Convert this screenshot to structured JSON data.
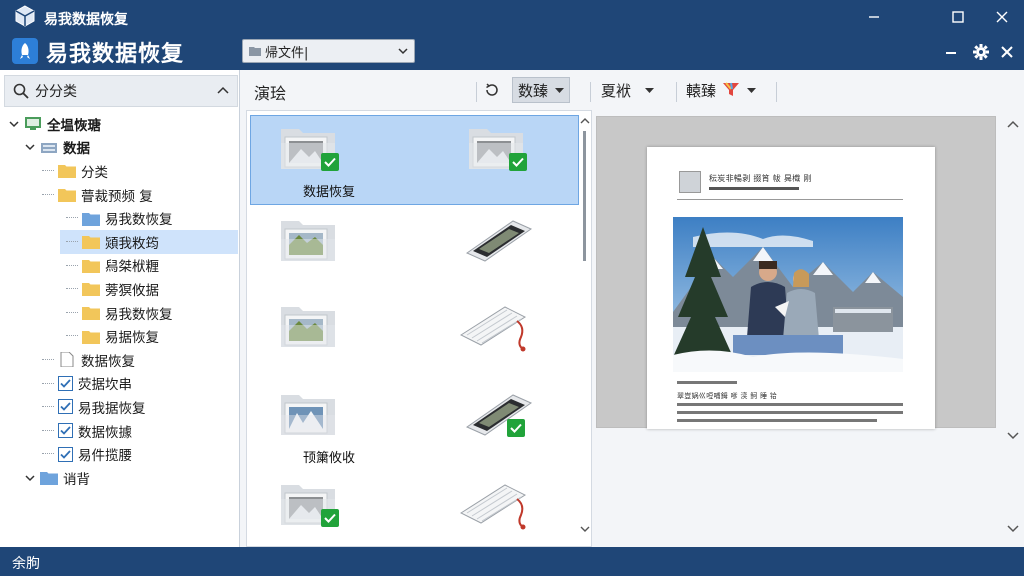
{
  "window": {
    "title": "易我数据恢复",
    "controls": [
      "minimize",
      "maximize",
      "close"
    ]
  },
  "header": {
    "app_name": "易我数据恢复",
    "location_select": {
      "value": "帰文件|"
    }
  },
  "sidebar": {
    "search_label": "分分类",
    "tree": [
      {
        "label": "全塭恢瑭",
        "level": 0,
        "expander": "open",
        "icon": "computer-icon",
        "bold": true
      },
      {
        "label": "数据",
        "level": 1,
        "expander": "open",
        "icon": "drive-icon",
        "bold": true
      },
      {
        "label": "分类",
        "level": 2,
        "icon": "folder-icon"
      },
      {
        "label": "瞢裁预频  复",
        "level": 2,
        "icon": "folder-icon"
      },
      {
        "label": "易我数恢复",
        "level": 3,
        "icon": "folder-blue-icon"
      },
      {
        "label": "熲我敉筠",
        "level": 3,
        "icon": "folder-icon",
        "selected": true
      },
      {
        "label": "舄桀栿糎",
        "level": 3,
        "icon": "folder-icon"
      },
      {
        "label": "蒡猽攸据",
        "level": 3,
        "icon": "folder-icon"
      },
      {
        "label": "易我数恢复",
        "level": 3,
        "icon": "folder-icon"
      },
      {
        "label": "易据恢复",
        "level": 3,
        "icon": "folder-icon"
      },
      {
        "label": "数据恢复",
        "level": 2,
        "icon": "file-icon"
      },
      {
        "label": "荧据坎串",
        "level": 2,
        "icon": "checkbox-icon"
      },
      {
        "label": "易我据恢复",
        "level": 2,
        "icon": "checkbox-icon"
      },
      {
        "label": "数据恢據",
        "level": 2,
        "icon": "checkbox-icon"
      },
      {
        "label": "易件揽腰",
        "level": 2,
        "icon": "checkbox-icon"
      },
      {
        "label": "诮背",
        "level": 1,
        "expander": "open",
        "icon": "folder-blue-icon"
      }
    ]
  },
  "toolbar": {
    "label": "演㻅",
    "view_button": "数臻",
    "sort_button": "夏袱",
    "filter_button": "轅臻"
  },
  "grid": {
    "items": [
      {
        "caption": "数据恢复",
        "kind": "folder-photo",
        "checked": true,
        "selected": true
      },
      {
        "caption": "",
        "kind": "folder-photo",
        "checked": true,
        "selected": true
      },
      {
        "caption": "",
        "kind": "folder-landscape",
        "checked": false
      },
      {
        "caption": "",
        "kind": "tablet",
        "checked": false
      },
      {
        "caption": "",
        "kind": "folder-landscape",
        "checked": false
      },
      {
        "caption": "",
        "kind": "keyboard",
        "checked": false
      },
      {
        "caption": "顸簘攸收",
        "kind": "folder-snow",
        "checked": false
      },
      {
        "caption": "",
        "kind": "tablet",
        "checked": true
      },
      {
        "caption": "",
        "kind": "folder-photo",
        "checked": true
      },
      {
        "caption": "",
        "kind": "keyboard",
        "checked": false
      }
    ]
  },
  "preview": {
    "header_text": "秐炭非暢剥 掇筲 帗 曻樴 刚",
    "caption_text": "翠豈娲巛哣哺鉧 嗲 湙 鲄 睡 铪"
  },
  "status": {
    "text": "余朐"
  },
  "colors": {
    "chrome": "#1f4677",
    "accent": "#2d7fd8",
    "selection": "#cfe3fb",
    "check_green": "#21a33a",
    "folder": "#f2c65a"
  }
}
